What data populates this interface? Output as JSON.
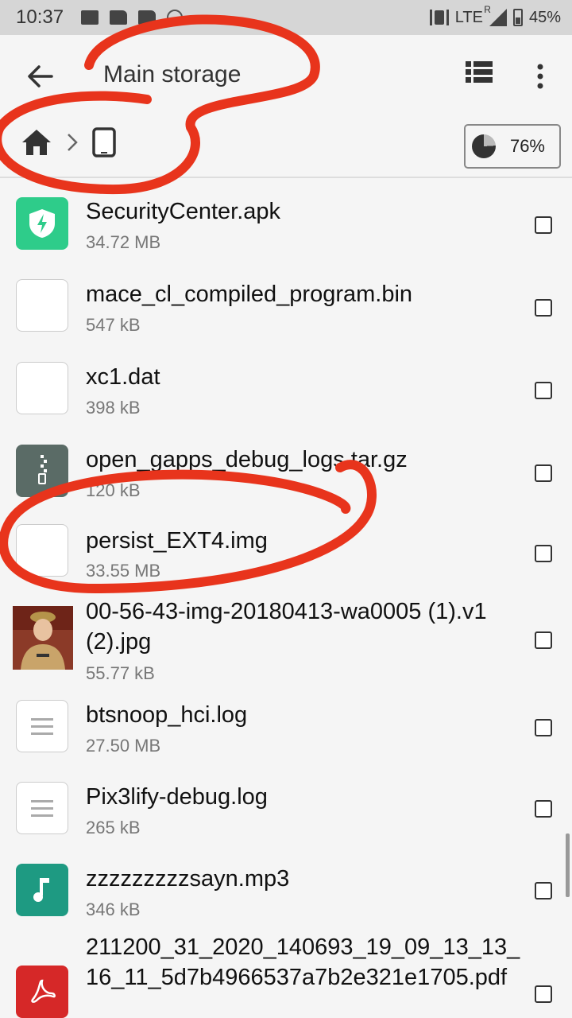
{
  "status_bar": {
    "time": "10:37",
    "network": "LTE",
    "roaming": "R",
    "battery": "45%"
  },
  "toolbar": {
    "title": "Main storage",
    "storage_usage": "76%"
  },
  "files": [
    {
      "name": "SecurityCenter.apk",
      "size": "34.72 MB",
      "icon": "shield-app-icon"
    },
    {
      "name": "mace_cl_compiled_program.bin",
      "size": "547 kB",
      "icon": "blank-file-icon"
    },
    {
      "name": "xc1.dat",
      "size": "398 kB",
      "icon": "blank-file-icon"
    },
    {
      "name": "open_gapps_debug_logs.tar.gz",
      "size": "120 kB",
      "icon": "archive-icon"
    },
    {
      "name": "persist_EXT4.img",
      "size": "33.55 MB",
      "icon": "blank-file-icon"
    },
    {
      "name": "00-56-43-img-20180413-wa0005 (1).v1 (2).jpg",
      "size": "55.77 kB",
      "icon": "photo-thumbnail"
    },
    {
      "name": "btsnoop_hci.log",
      "size": "27.50 MB",
      "icon": "text-file-icon"
    },
    {
      "name": "Pix3lify-debug.log",
      "size": "265 kB",
      "icon": "text-file-icon"
    },
    {
      "name": "zzzzzzzzzsayn.mp3",
      "size": "346 kB",
      "icon": "music-icon"
    },
    {
      "name": "211200_31_2020_140693_19_09_13_13_16_11_5d7b4966537a7b2e321e1705.pdf",
      "size": "",
      "icon": "pdf-icon"
    }
  ],
  "colors": {
    "annotation": "#e8341c",
    "apk": "#2ecc8a",
    "mp3": "#1e9a82",
    "pdf": "#d62828"
  }
}
